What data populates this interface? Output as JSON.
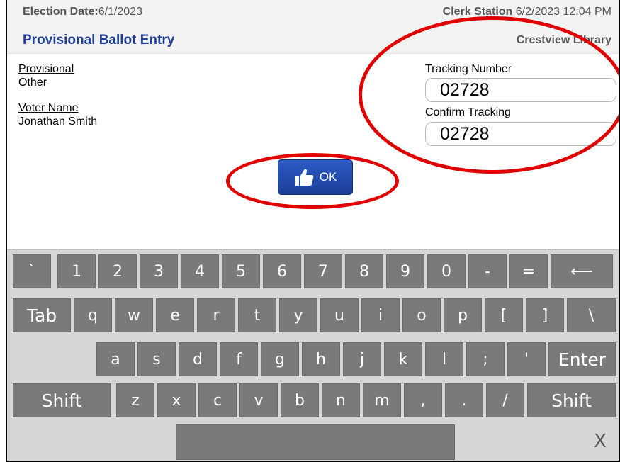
{
  "header": {
    "election_date_label": "Election Date:",
    "election_date_value": "6/1/2023",
    "screen_title": "Provisional Ballot Entry",
    "station_label": "Clerk Station",
    "station_datetime": "6/2/2023 12:04 PM",
    "location": "Crestview Library"
  },
  "fields": {
    "provisional_label": "Provisional",
    "provisional_value": "Other",
    "voter_name_label": "Voter Name",
    "voter_name_value": "Jonathan Smith",
    "tracking_label": "Tracking Number",
    "tracking_value": "02728",
    "confirm_label": "Confirm Tracking",
    "confirm_value": "02728"
  },
  "ok_button": {
    "label": "OK",
    "icon": "thumbs-up-icon"
  },
  "annotation_color": "#e00000",
  "keyboard": {
    "row1": [
      "`",
      "1",
      "2",
      "3",
      "4",
      "5",
      "6",
      "7",
      "8",
      "9",
      "0",
      "-",
      "=",
      "⟵"
    ],
    "row2": [
      "Tab",
      "q",
      "w",
      "e",
      "r",
      "t",
      "y",
      "u",
      "i",
      "o",
      "p",
      "[",
      "]",
      "\\"
    ],
    "row3": [
      "a",
      "s",
      "d",
      "f",
      "g",
      "h",
      "j",
      "k",
      "l",
      ";",
      "'",
      "Enter"
    ],
    "row4": [
      "Shift",
      "z",
      "x",
      "c",
      "v",
      "b",
      "n",
      "m",
      ",",
      ".",
      "/",
      "Shift"
    ],
    "space": "",
    "close": "X"
  },
  "colors": {
    "title_blue": "#1f3c96",
    "button_blue": "#2d5bc8",
    "key_gray": "#7a7a7a",
    "keyboard_bg": "#d6d6d6"
  }
}
